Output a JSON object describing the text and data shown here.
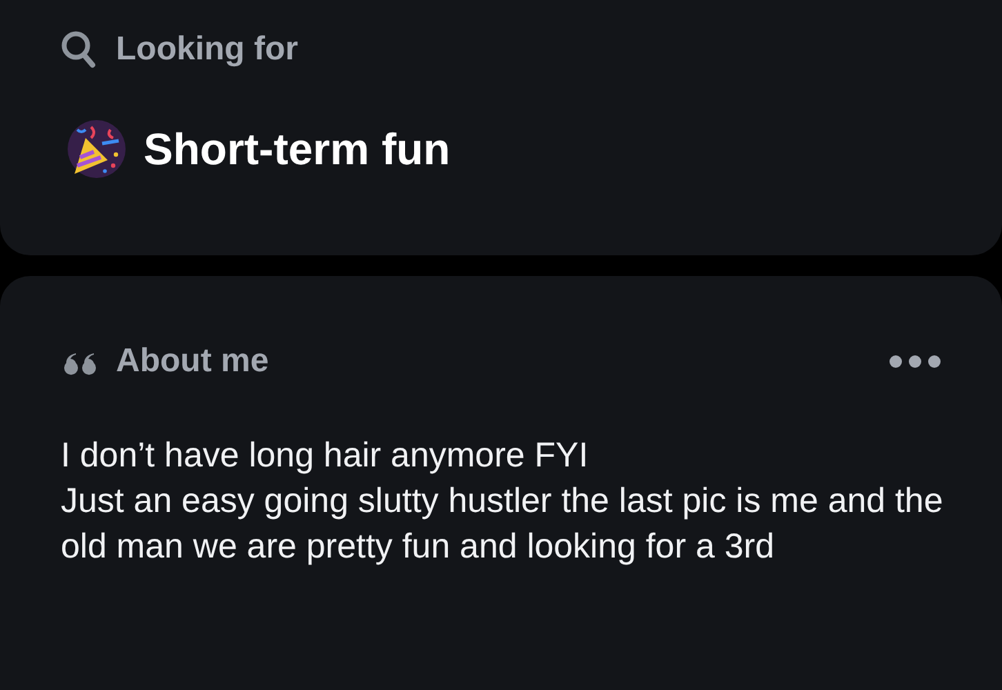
{
  "looking_for": {
    "label": "Looking for",
    "value": "Short-term fun"
  },
  "about_me": {
    "label": "About me",
    "text": "I don’t have long hair anymore FYI\nJust an easy going slutty hustler the last pic is me and the old man we are pretty fun and looking for a 3rd"
  }
}
